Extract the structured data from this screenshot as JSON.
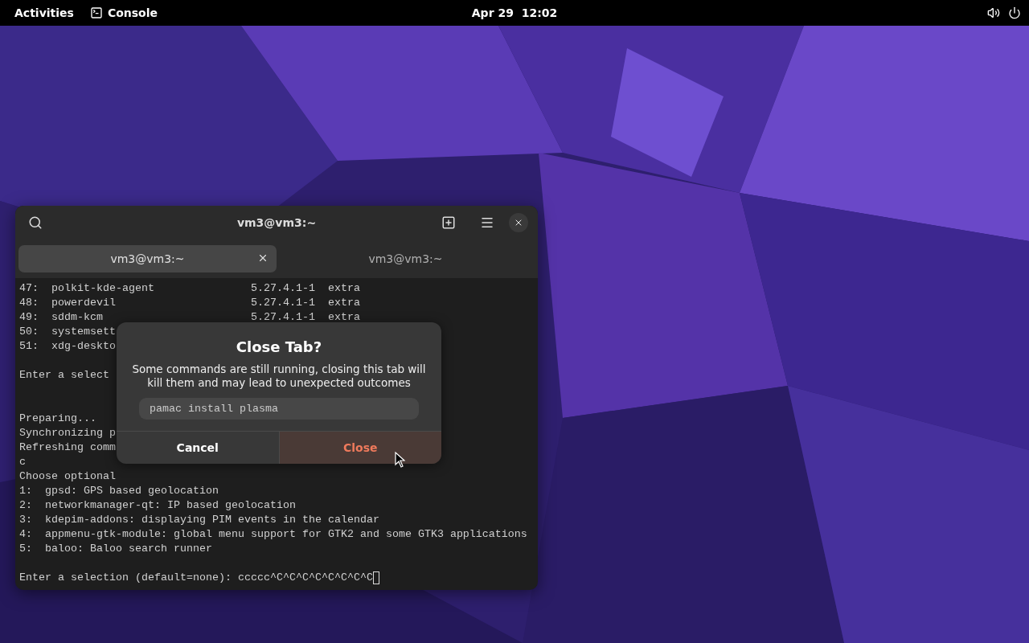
{
  "top_bar": {
    "activities": "Activities",
    "app": {
      "label": "Console"
    },
    "clock": "Apr 29  12:02"
  },
  "terminal_window": {
    "title": "vm3@vm3:~",
    "tabs": [
      {
        "label": "vm3@vm3:~",
        "selected": true
      },
      {
        "label": "vm3@vm3:~",
        "selected": false
      }
    ],
    "lines": [
      {
        "kind": "text",
        "text": "47:  polkit-kde-agent               5.27.4.1-1  extra"
      },
      {
        "kind": "text",
        "text": "48:  powerdevil                     5.27.4.1-1  extra"
      },
      {
        "kind": "text",
        "text": "49:  sddm-kcm                       5.27.4.1-1  extra"
      },
      {
        "kind": "text",
        "text": "50:  systemsett"
      },
      {
        "kind": "text",
        "text": "51:  xdg-deskto"
      },
      {
        "kind": "blank"
      },
      {
        "kind": "text",
        "text": "Enter a select"
      },
      {
        "kind": "blank"
      },
      {
        "kind": "blank"
      },
      {
        "kind": "text",
        "text": "Preparing..."
      },
      {
        "kind": "text",
        "text": "Synchronizing p"
      },
      {
        "kind": "text",
        "text": "Refreshing comm"
      },
      {
        "kind": "text",
        "text": "c"
      },
      {
        "kind": "text",
        "text": "Choose optional"
      },
      {
        "kind": "text",
        "text": "1:  gpsd: GPS based geolocation"
      },
      {
        "kind": "text",
        "text": "2:  networkmanager-qt: IP based geolocation"
      },
      {
        "kind": "text",
        "text": "3:  kdepim-addons: displaying PIM events in the calendar"
      },
      {
        "kind": "text",
        "text": "4:  appmenu-gtk-module: global menu support for GTK2 and some GTK3 applications"
      },
      {
        "kind": "text",
        "text": "5:  baloo: Baloo search runner"
      },
      {
        "kind": "blank"
      },
      {
        "kind": "prompt",
        "text": "Enter a selection (default=none): ccccc^C^C^C^C^C^C^C^C"
      }
    ]
  },
  "dialog": {
    "title": "Close Tab?",
    "message": "Some commands are still running, closing this tab will kill them and may lead to unexpected outcomes",
    "command": "pamac install plasma",
    "buttons": [
      {
        "label": "Cancel",
        "kind": "default"
      },
      {
        "label": "Close",
        "kind": "destructive"
      }
    ]
  }
}
